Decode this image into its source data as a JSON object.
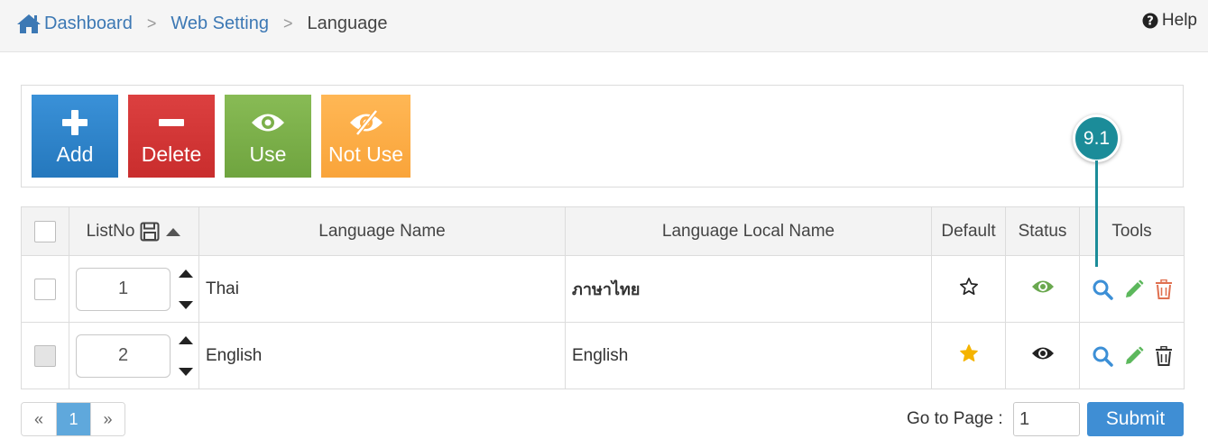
{
  "breadcrumb": {
    "items": [
      {
        "label": "Dashboard",
        "icon": "home-icon"
      },
      {
        "label": "Web Setting"
      },
      {
        "label": "Language"
      }
    ]
  },
  "help": {
    "label": "Help",
    "icon": "question-circle-icon"
  },
  "toolbar": {
    "add_label": "Add",
    "delete_label": "Delete",
    "use_label": "Use",
    "not_use_label": "Not Use"
  },
  "callout": {
    "label": "9.1",
    "color": "#1b8c99"
  },
  "table": {
    "headers": {
      "listno": "ListNo",
      "name": "Language Name",
      "local_name": "Language Local Name",
      "default": "Default",
      "status": "Status",
      "tools": "Tools"
    },
    "rows": [
      {
        "order": "1",
        "name": "Thai",
        "local_name": "ภาษาไทย",
        "default": false,
        "status": "use"
      },
      {
        "order": "2",
        "name": "English",
        "local_name": "English",
        "default": true,
        "status": "use"
      }
    ]
  },
  "pagination": {
    "prev": "«",
    "current": "1",
    "next": "»"
  },
  "goto": {
    "label": "Go to Page :",
    "value": "1",
    "submit_label": "Submit"
  },
  "colors": {
    "link": "#3c78b4",
    "add": "#2e86cf",
    "delete": "#d23636",
    "use": "#7cb04a",
    "not_use": "#fdad48",
    "star": "#f5b400",
    "eye_active": "#6aa84f",
    "tool_view": "#3c8fd6",
    "tool_edit": "#5cb85c",
    "tool_delete": "#e07050"
  }
}
